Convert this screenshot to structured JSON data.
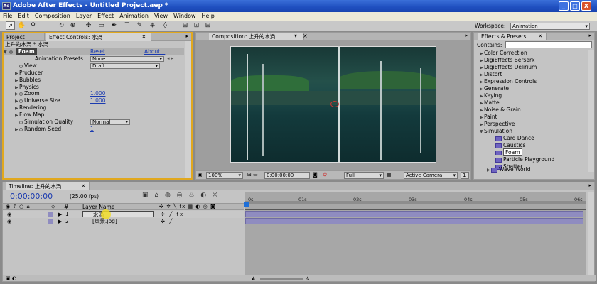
{
  "window": {
    "title": "Adobe After Effects - Untitled Project.aep *",
    "minimize": "_",
    "maximize": "□",
    "close": "X"
  },
  "menu": [
    "File",
    "Edit",
    "Composition",
    "Layer",
    "Effect",
    "Animation",
    "View",
    "Window",
    "Help"
  ],
  "toolbar": {
    "workspace_label": "Workspace:",
    "workspace_value": "Animation"
  },
  "project_panel": {
    "tabs": [
      "Project",
      "Effect Controls: 水渦"
    ],
    "breadcrumb": "上升的水渦 * 水渦",
    "effect_name": "Foam",
    "reset": "Reset",
    "about": "About...",
    "anim_presets_label": "Animation Presets:",
    "anim_presets_value": "None",
    "rows": [
      {
        "label": "View",
        "value": "Draft"
      },
      {
        "label": "Producer"
      },
      {
        "label": "Bubbles"
      },
      {
        "label": "Physics"
      },
      {
        "label": "Zoom",
        "value": "1.000"
      },
      {
        "label": "Universe Size",
        "value": "1.000"
      },
      {
        "label": "Rendering"
      },
      {
        "label": "Flow Map"
      },
      {
        "label": "Simulation Quality",
        "value": "Normal"
      },
      {
        "label": "Random Seed",
        "value": "1"
      }
    ]
  },
  "comp_panel": {
    "tab": "Composition: 上升的水渦",
    "zoom": "100%",
    "timecode": "0:00:00:00",
    "resolution": "Full",
    "camera": "Active Camera",
    "views": "1"
  },
  "effects_panel": {
    "tab": "Effects & Presets",
    "contains_label": "Contains:",
    "categories": [
      "Color Correction",
      "DigiEffects Berserk",
      "DigiEffects Delirium",
      "Distort",
      "Expression Controls",
      "Generate",
      "Keying",
      "Matte",
      "Noise & Grain",
      "Paint",
      "Perspective",
      "Simulation"
    ],
    "simulation_items": [
      "Card Dance",
      "Caustics",
      "Foam",
      "Particle Playground",
      "Shatter",
      "Wave World"
    ],
    "selected": "Foam"
  },
  "timeline": {
    "tab": "Timeline: 上升的水渦",
    "timecode": "0:00:00:00",
    "fps": "(25.00 fps)",
    "column_num": "#",
    "column_name": "Layer Name",
    "ruler": [
      "0s",
      "01s",
      "02s",
      "03s",
      "04s",
      "05s",
      "06s"
    ],
    "layers": [
      {
        "num": "1",
        "name": "水渦"
      },
      {
        "num": "2",
        "name": "[风景.jpg]"
      }
    ]
  },
  "colors": {
    "title_bar": "#1f4fbf",
    "panel_bg": "#c4c4c4",
    "highlight": "#f2c43a",
    "layer_bar": "#8f8cc0",
    "playhead": "#d22"
  }
}
